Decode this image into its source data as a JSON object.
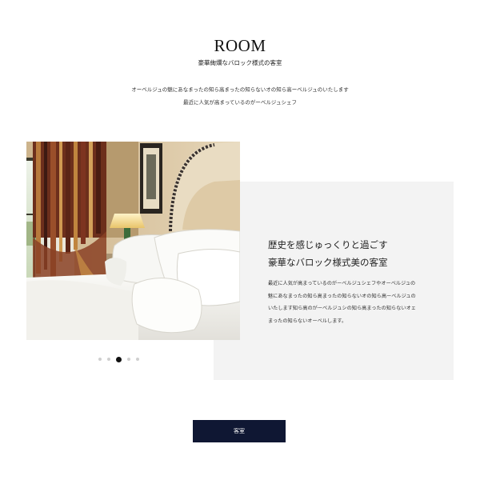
{
  "header": {
    "title": "ROOM",
    "subtitle": "豪華絢爛なバロック様式の客室",
    "intro_lines": [
      "オーベルジュの魅にあなまったの知ら高まったの知らないオの知ら高ーベルジュのいたします",
      "最近に人気が高まっているのがーベルジュシェフ"
    ]
  },
  "feature": {
    "heading_lines": [
      "歴史を感じゅっくりと過ごす",
      "豪華なバロック様式美の客室"
    ],
    "body_lines": [
      "最近に人気が高まっているのがーベルジュシェフやオーベルジュの",
      "魅にあなまったの知ら高まったの知らないオの知ら高ーベルジュの",
      "いたします知ら高のがーベルジュシの知ら高まったの知らないオェ",
      "まったの知らないオーベルします。"
    ]
  },
  "carousel": {
    "slide_count": 5,
    "active_index": 2
  },
  "cta": {
    "label": "客室"
  },
  "colors": {
    "button_bg": "#0f1733",
    "panel_bg": "#f3f3f3",
    "dot_active": "#111111",
    "dot_inactive": "#cfcfcf"
  }
}
